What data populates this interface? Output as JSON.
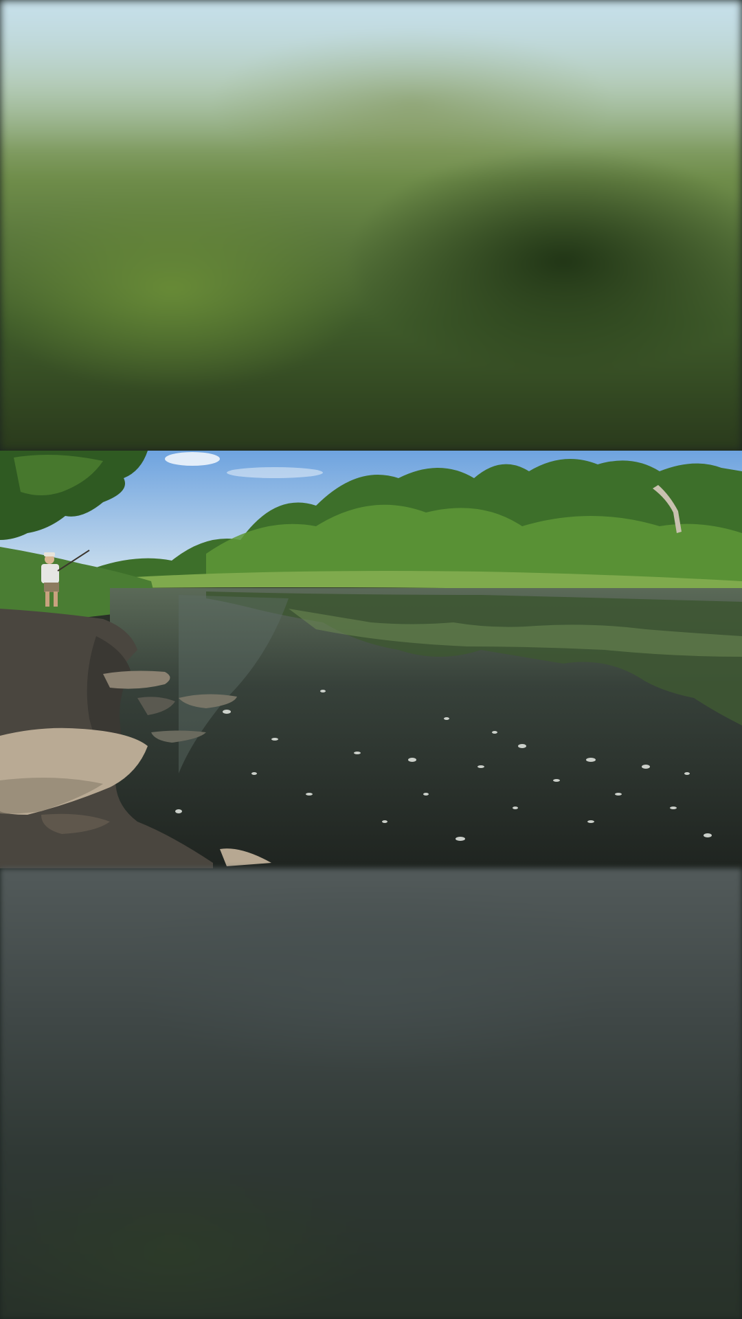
{
  "scene": {
    "layout": "vertical-video-with-blurred-fill",
    "subject": "river-bank-fishing",
    "colors": {
      "sky": "#8fb7e8",
      "foliage_dark": "#2f5a22",
      "foliage_light": "#6ea23f",
      "water": "#2b302b",
      "bank": "#4a463f",
      "rock": "#b9aa94"
    },
    "icons": []
  }
}
